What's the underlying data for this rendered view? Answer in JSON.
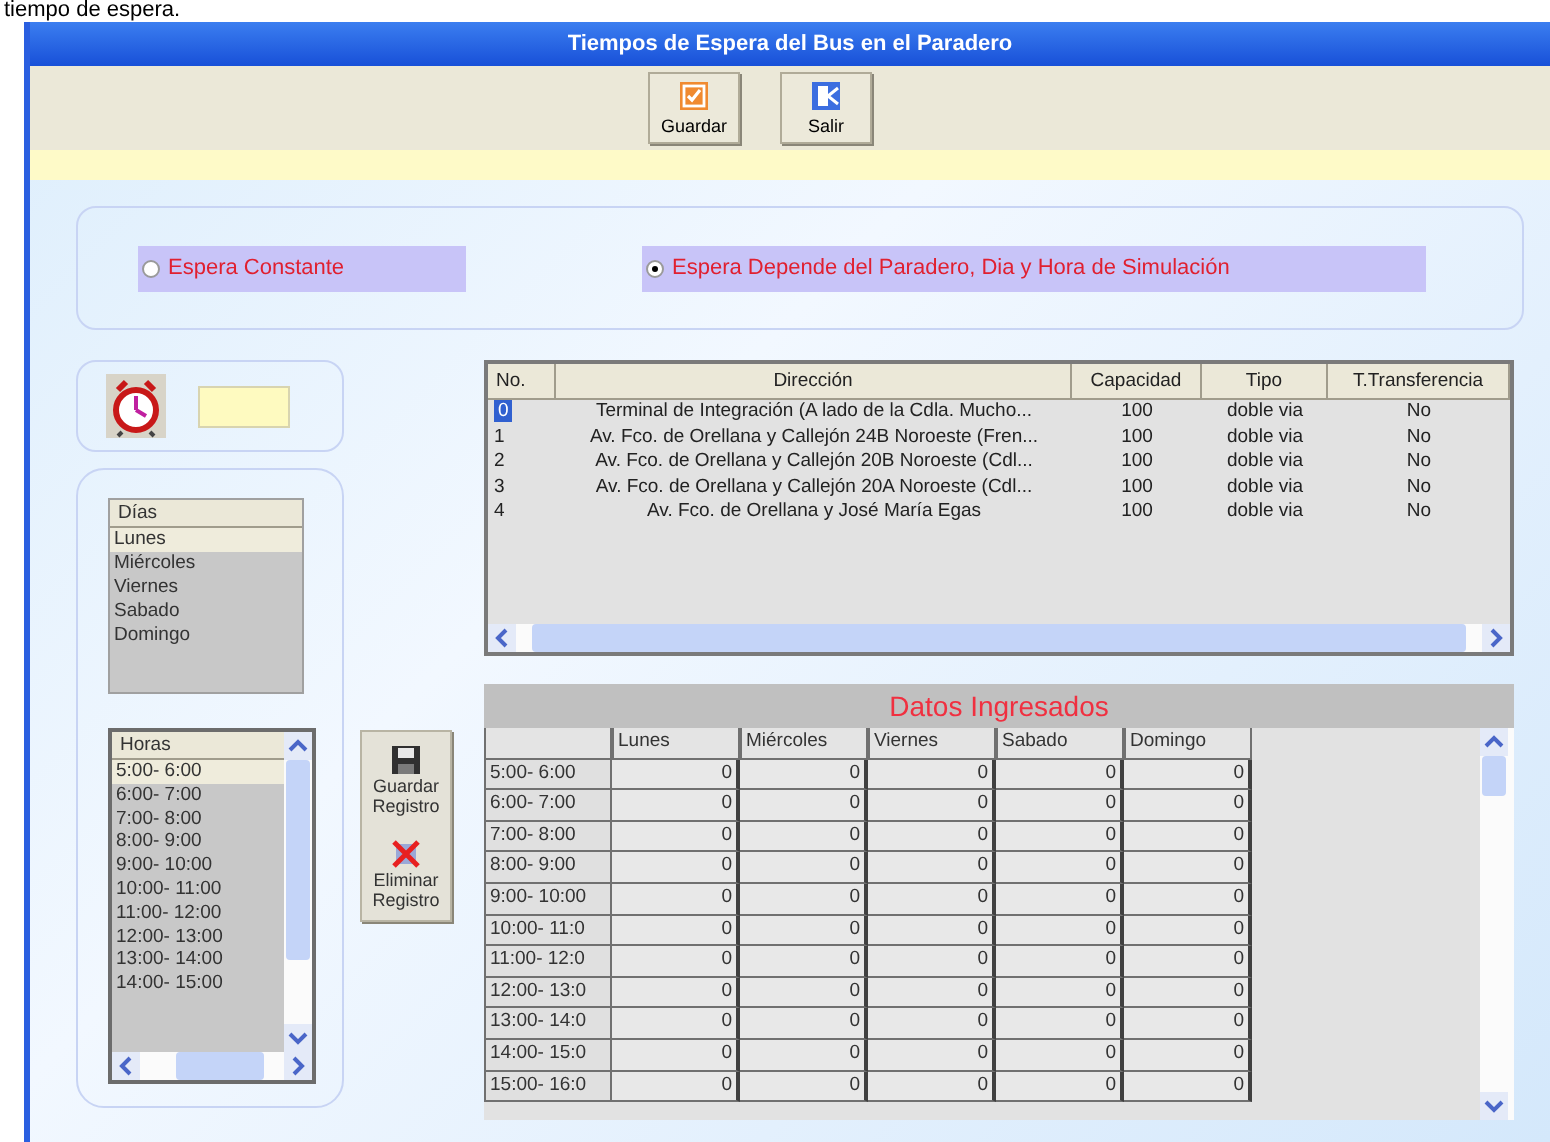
{
  "document_text": "tiempo de espera.",
  "window": {
    "title": "Tiempos de Espera del Bus en el Paradero"
  },
  "toolbar": [
    {
      "label": "Guardar",
      "kind": "save"
    },
    {
      "label": "Salir",
      "kind": "exit"
    }
  ],
  "wait_mode": [
    {
      "label": "Espera Constante",
      "selected": false
    },
    {
      "label": "Espera Depende del Paradero, Dia y Hora de Simulación",
      "selected": true
    }
  ],
  "days_list": {
    "header": "Días",
    "items": [
      {
        "label": "Lunes",
        "selected": true
      },
      {
        "label": "Miércoles",
        "selected": false
      },
      {
        "label": "Viernes",
        "selected": false
      },
      {
        "label": "Sabado",
        "selected": false
      },
      {
        "label": "Domingo",
        "selected": false
      }
    ]
  },
  "hours_list": {
    "header": "Horas",
    "items": [
      {
        "label": "5:00- 6:00",
        "selected": true
      },
      {
        "label": "6:00- 7:00",
        "selected": false
      },
      {
        "label": "7:00- 8:00",
        "selected": false
      },
      {
        "label": "8:00- 9:00",
        "selected": false
      },
      {
        "label": "9:00- 10:00",
        "selected": false
      },
      {
        "label": "10:00- 11:00",
        "selected": false
      },
      {
        "label": "11:00- 12:00",
        "selected": false
      },
      {
        "label": "12:00- 13:00",
        "selected": false
      },
      {
        "label": "13:00- 14:00",
        "selected": false
      },
      {
        "label": "14:00- 15:00",
        "selected": false
      }
    ]
  },
  "record_buttons": [
    {
      "label": "Guardar Registro",
      "kind": "save"
    },
    {
      "label": "Eliminar Registro",
      "kind": "delete"
    }
  ],
  "stops_table": {
    "columns": [
      "No.",
      "Dirección",
      "Capacidad",
      "Tipo",
      "T.Transferencia"
    ],
    "rows": [
      {
        "selected": true,
        "cells": [
          "0",
          "Terminal de Integración (A lado de la Cdla. Mucho...",
          "100",
          "doble via",
          "No"
        ]
      },
      {
        "selected": false,
        "cells": [
          "1",
          "Av. Fco. de Orellana y Callejón 24B Noroeste (Fren...",
          "100",
          "doble via",
          "No"
        ]
      },
      {
        "selected": false,
        "cells": [
          "2",
          "Av. Fco. de Orellana y Callejón 20B Noroeste (Cdl...",
          "100",
          "doble via",
          "No"
        ]
      },
      {
        "selected": false,
        "cells": [
          "3",
          "Av. Fco. de Orellana y Callejón 20A Noroeste (Cdl...",
          "100",
          "doble via",
          "No"
        ]
      },
      {
        "selected": false,
        "cells": [
          "4",
          "Av. Fco. de Orellana y José María Egas",
          "100",
          "doble via",
          "No"
        ]
      }
    ]
  },
  "entered_data": {
    "title": "Datos Ingresados",
    "columns": [
      "Lunes",
      "Miércoles",
      "Viernes",
      "Sabado",
      "Domingo"
    ],
    "rows": [
      {
        "label": "5:00- 6:00",
        "values": [
          "0",
          "0",
          "0",
          "0",
          "0"
        ]
      },
      {
        "label": "6:00- 7:00",
        "values": [
          "0",
          "0",
          "0",
          "0",
          "0"
        ]
      },
      {
        "label": "7:00- 8:00",
        "values": [
          "0",
          "0",
          "0",
          "0",
          "0"
        ]
      },
      {
        "label": "8:00- 9:00",
        "values": [
          "0",
          "0",
          "0",
          "0",
          "0"
        ]
      },
      {
        "label": "9:00- 10:00",
        "values": [
          "0",
          "0",
          "0",
          "0",
          "0"
        ]
      },
      {
        "label": "10:00- 11:0",
        "values": [
          "0",
          "0",
          "0",
          "0",
          "0"
        ]
      },
      {
        "label": "11:00- 12:0",
        "values": [
          "0",
          "0",
          "0",
          "0",
          "0"
        ]
      },
      {
        "label": "12:00- 13:0",
        "values": [
          "0",
          "0",
          "0",
          "0",
          "0"
        ]
      },
      {
        "label": "13:00- 14:0",
        "values": [
          "0",
          "0",
          "0",
          "0",
          "0"
        ]
      },
      {
        "label": "14:00- 15:0",
        "values": [
          "0",
          "0",
          "0",
          "0",
          "0"
        ]
      },
      {
        "label": "15:00- 16:0",
        "values": [
          "0",
          "0",
          "0",
          "0",
          "0"
        ]
      }
    ]
  }
}
